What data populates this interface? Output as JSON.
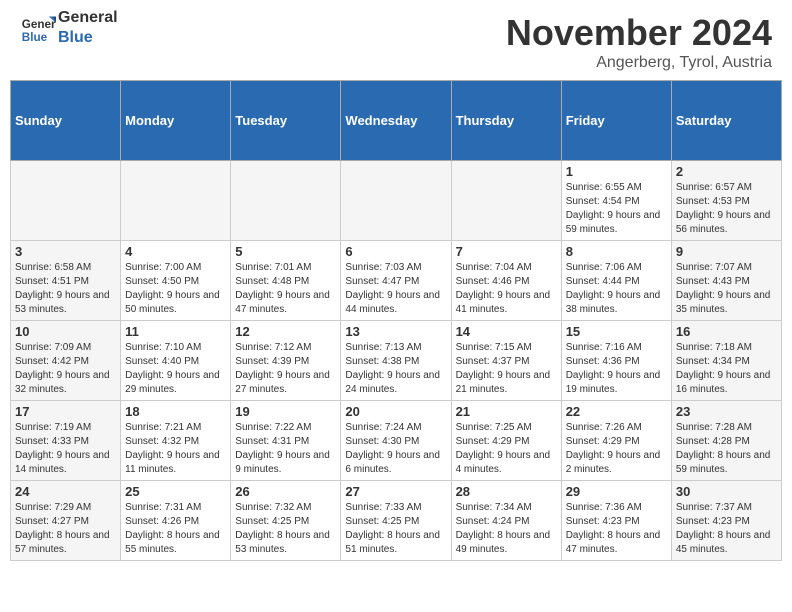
{
  "header": {
    "logo_line1": "General",
    "logo_line2": "Blue",
    "month_title": "November 2024",
    "location": "Angerberg, Tyrol, Austria"
  },
  "weekdays": [
    "Sunday",
    "Monday",
    "Tuesday",
    "Wednesday",
    "Thursday",
    "Friday",
    "Saturday"
  ],
  "weeks": [
    [
      {
        "day": "",
        "empty": true
      },
      {
        "day": "",
        "empty": true
      },
      {
        "day": "",
        "empty": true
      },
      {
        "day": "",
        "empty": true
      },
      {
        "day": "",
        "empty": true
      },
      {
        "day": "1",
        "sunrise": "Sunrise: 6:55 AM",
        "sunset": "Sunset: 4:54 PM",
        "daylight": "Daylight: 9 hours and 59 minutes."
      },
      {
        "day": "2",
        "sunrise": "Sunrise: 6:57 AM",
        "sunset": "Sunset: 4:53 PM",
        "daylight": "Daylight: 9 hours and 56 minutes."
      }
    ],
    [
      {
        "day": "3",
        "sunrise": "Sunrise: 6:58 AM",
        "sunset": "Sunset: 4:51 PM",
        "daylight": "Daylight: 9 hours and 53 minutes."
      },
      {
        "day": "4",
        "sunrise": "Sunrise: 7:00 AM",
        "sunset": "Sunset: 4:50 PM",
        "daylight": "Daylight: 9 hours and 50 minutes."
      },
      {
        "day": "5",
        "sunrise": "Sunrise: 7:01 AM",
        "sunset": "Sunset: 4:48 PM",
        "daylight": "Daylight: 9 hours and 47 minutes."
      },
      {
        "day": "6",
        "sunrise": "Sunrise: 7:03 AM",
        "sunset": "Sunset: 4:47 PM",
        "daylight": "Daylight: 9 hours and 44 minutes."
      },
      {
        "day": "7",
        "sunrise": "Sunrise: 7:04 AM",
        "sunset": "Sunset: 4:46 PM",
        "daylight": "Daylight: 9 hours and 41 minutes."
      },
      {
        "day": "8",
        "sunrise": "Sunrise: 7:06 AM",
        "sunset": "Sunset: 4:44 PM",
        "daylight": "Daylight: 9 hours and 38 minutes."
      },
      {
        "day": "9",
        "sunrise": "Sunrise: 7:07 AM",
        "sunset": "Sunset: 4:43 PM",
        "daylight": "Daylight: 9 hours and 35 minutes."
      }
    ],
    [
      {
        "day": "10",
        "sunrise": "Sunrise: 7:09 AM",
        "sunset": "Sunset: 4:42 PM",
        "daylight": "Daylight: 9 hours and 32 minutes."
      },
      {
        "day": "11",
        "sunrise": "Sunrise: 7:10 AM",
        "sunset": "Sunset: 4:40 PM",
        "daylight": "Daylight: 9 hours and 29 minutes."
      },
      {
        "day": "12",
        "sunrise": "Sunrise: 7:12 AM",
        "sunset": "Sunset: 4:39 PM",
        "daylight": "Daylight: 9 hours and 27 minutes."
      },
      {
        "day": "13",
        "sunrise": "Sunrise: 7:13 AM",
        "sunset": "Sunset: 4:38 PM",
        "daylight": "Daylight: 9 hours and 24 minutes."
      },
      {
        "day": "14",
        "sunrise": "Sunrise: 7:15 AM",
        "sunset": "Sunset: 4:37 PM",
        "daylight": "Daylight: 9 hours and 21 minutes."
      },
      {
        "day": "15",
        "sunrise": "Sunrise: 7:16 AM",
        "sunset": "Sunset: 4:36 PM",
        "daylight": "Daylight: 9 hours and 19 minutes."
      },
      {
        "day": "16",
        "sunrise": "Sunrise: 7:18 AM",
        "sunset": "Sunset: 4:34 PM",
        "daylight": "Daylight: 9 hours and 16 minutes."
      }
    ],
    [
      {
        "day": "17",
        "sunrise": "Sunrise: 7:19 AM",
        "sunset": "Sunset: 4:33 PM",
        "daylight": "Daylight: 9 hours and 14 minutes."
      },
      {
        "day": "18",
        "sunrise": "Sunrise: 7:21 AM",
        "sunset": "Sunset: 4:32 PM",
        "daylight": "Daylight: 9 hours and 11 minutes."
      },
      {
        "day": "19",
        "sunrise": "Sunrise: 7:22 AM",
        "sunset": "Sunset: 4:31 PM",
        "daylight": "Daylight: 9 hours and 9 minutes."
      },
      {
        "day": "20",
        "sunrise": "Sunrise: 7:24 AM",
        "sunset": "Sunset: 4:30 PM",
        "daylight": "Daylight: 9 hours and 6 minutes."
      },
      {
        "day": "21",
        "sunrise": "Sunrise: 7:25 AM",
        "sunset": "Sunset: 4:29 PM",
        "daylight": "Daylight: 9 hours and 4 minutes."
      },
      {
        "day": "22",
        "sunrise": "Sunrise: 7:26 AM",
        "sunset": "Sunset: 4:29 PM",
        "daylight": "Daylight: 9 hours and 2 minutes."
      },
      {
        "day": "23",
        "sunrise": "Sunrise: 7:28 AM",
        "sunset": "Sunset: 4:28 PM",
        "daylight": "Daylight: 8 hours and 59 minutes."
      }
    ],
    [
      {
        "day": "24",
        "sunrise": "Sunrise: 7:29 AM",
        "sunset": "Sunset: 4:27 PM",
        "daylight": "Daylight: 8 hours and 57 minutes."
      },
      {
        "day": "25",
        "sunrise": "Sunrise: 7:31 AM",
        "sunset": "Sunset: 4:26 PM",
        "daylight": "Daylight: 8 hours and 55 minutes."
      },
      {
        "day": "26",
        "sunrise": "Sunrise: 7:32 AM",
        "sunset": "Sunset: 4:25 PM",
        "daylight": "Daylight: 8 hours and 53 minutes."
      },
      {
        "day": "27",
        "sunrise": "Sunrise: 7:33 AM",
        "sunset": "Sunset: 4:25 PM",
        "daylight": "Daylight: 8 hours and 51 minutes."
      },
      {
        "day": "28",
        "sunrise": "Sunrise: 7:34 AM",
        "sunset": "Sunset: 4:24 PM",
        "daylight": "Daylight: 8 hours and 49 minutes."
      },
      {
        "day": "29",
        "sunrise": "Sunrise: 7:36 AM",
        "sunset": "Sunset: 4:23 PM",
        "daylight": "Daylight: 8 hours and 47 minutes."
      },
      {
        "day": "30",
        "sunrise": "Sunrise: 7:37 AM",
        "sunset": "Sunset: 4:23 PM",
        "daylight": "Daylight: 8 hours and 45 minutes."
      }
    ]
  ]
}
